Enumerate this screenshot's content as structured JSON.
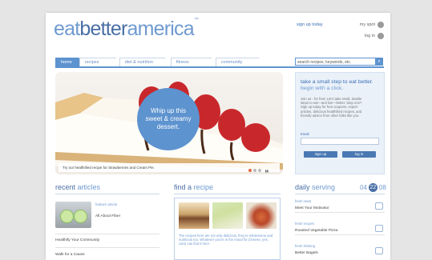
{
  "logo": {
    "part1": "eat",
    "part2": "better",
    "part3": "america",
    "tm": "™"
  },
  "header": {
    "signup": "sign up today",
    "my_spot": "my spot",
    "login": "log in"
  },
  "nav": {
    "tabs": [
      "home",
      "recipes",
      "diet & nutrition",
      "fitness",
      "community"
    ],
    "search_placeholder": "search recipes, keywords, etc."
  },
  "hero": {
    "bubble": "Whip up this sweet & creamy dessert.",
    "caption": "Try our healthified recipe for Strawberries and Cream Pie."
  },
  "signup_box": {
    "title1": "take a small step to eat better.",
    "title2": "begin with a click.",
    "body": "Join us - for free! Let's take small, doable steps to eat—and live—better. Step one? Sign up today for free coupons, expert articles, delicious healthified recipes, and friendly advice from other folks like you.",
    "email_label": "Email",
    "signup_button": "sign up",
    "login_button": "log in"
  },
  "recent_articles": {
    "heading_a": "recent",
    "heading_b": "articles",
    "feature_label": "feature article",
    "feature_title": "All About Fiber",
    "items": [
      "Healthify Your Community",
      "Walk for a Cause"
    ]
  },
  "find_recipe": {
    "heading_a": "find a",
    "heading_b": "recipe",
    "text": "The recipes here are not only delicious, they're wholesome and nutritious too. Whatever you're in the mood for (cheese, yes, cars) can find it here."
  },
  "daily_serving": {
    "heading_a": "daily",
    "heading_b": "serving",
    "prev": "04",
    "current": "22",
    "next": "08",
    "rows": [
      {
        "label": "fresh news",
        "title": "Meet Your Motivator"
      },
      {
        "label": "fresh recipes",
        "title": "Roasted Vegetable Pizza"
      },
      {
        "label": "fresh thinking",
        "title": "Better Bagels"
      }
    ]
  }
}
